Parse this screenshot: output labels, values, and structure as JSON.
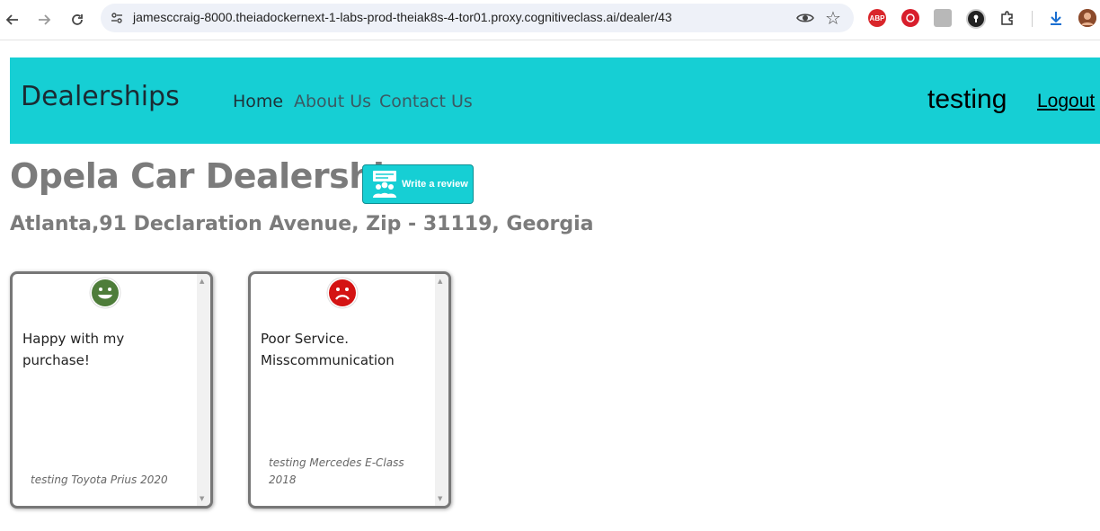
{
  "browser": {
    "url": "jamesccraig-8000.theiadockernext-1-labs-prod-theiak8s-4-tor01.proxy.cognitiveclass.ai/dealer/43",
    "back_icon": "arrow-left-icon",
    "forward_icon": "arrow-right-icon",
    "reload_icon": "reload-icon",
    "extensions": [
      {
        "name": "adblock-plus",
        "label": "ABP",
        "color": "#d9262b"
      },
      {
        "name": "red-extension",
        "label": "",
        "color": "#d81e2c"
      },
      {
        "name": "grey-extension",
        "label": "",
        "color": "#b8b8b8"
      },
      {
        "name": "password-extension",
        "label": "",
        "color": "#222222"
      },
      {
        "name": "puzzle-extension",
        "label": "",
        "color": "#444444"
      }
    ],
    "download_icon": "download-icon",
    "profile_icon": "profile-avatar-icon"
  },
  "nav": {
    "brand": "Dealerships",
    "links": [
      "Home",
      "About Us",
      "Contact Us"
    ],
    "username": "testing",
    "logout": "Logout",
    "color": "#16cfd4"
  },
  "dealer": {
    "name": "Opela Car Dealership",
    "address": "Atlanta,91 Declaration Avenue, Zip - 31119, Georgia",
    "review_button": "Write a review"
  },
  "reviews": [
    {
      "sentiment": "positive",
      "icon": "smiley-face-icon",
      "text": "Happy with my purchase!",
      "car_line1": "testing Toyota Prius 2020",
      "car_line2": ""
    },
    {
      "sentiment": "negative",
      "icon": "sad-face-icon",
      "text_line1": "Poor Service.",
      "text_line2": "Misscommunication",
      "car_line1": "testing Mercedes E-Class",
      "car_line2": "2018"
    }
  ]
}
